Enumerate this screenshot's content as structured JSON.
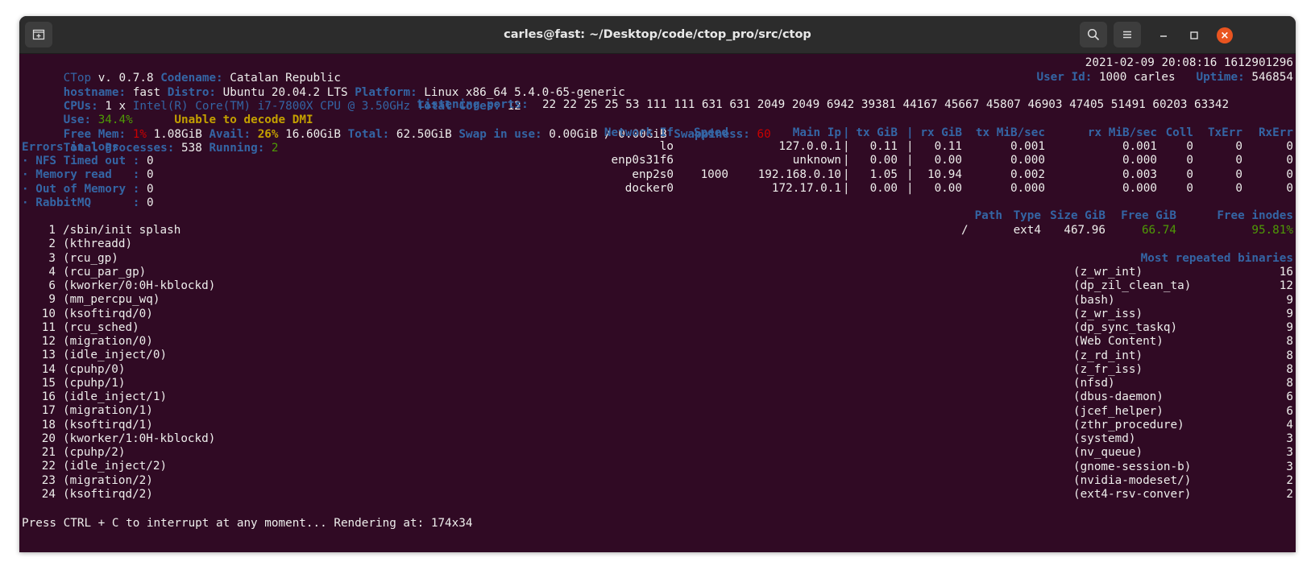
{
  "window": {
    "title": "carles@fast: ~/Desktop/code/ctop_pro/src/ctop"
  },
  "header": {
    "app": "CTop",
    "version": "v. 0.7.8",
    "codename_label": "Codename:",
    "codename": "Catalan Republic",
    "datetime": "2021-02-09 20:08:16 1612901296",
    "hostname_label": "hostname:",
    "hostname": "fast",
    "distro_label": "Distro:",
    "distro": "Ubuntu 20.04.2 LTS",
    "platform_label": "Platform:",
    "platform": "Linux x86_64 5.4.0-65-generic",
    "userid_label": "User Id:",
    "userid": "1000 carles",
    "uptime_label": "Uptime:",
    "uptime": "546854",
    "cpus_label": "CPUs:",
    "cpus_count": "1 x",
    "cpu_model": "Intel(R) Core(TM) i7-7800X CPU @ 3.50GHz",
    "total_cores_label": "Total Cores:",
    "total_cores": "12",
    "use_label": "Use:",
    "use_value": "34.4%",
    "dmi_warning": "Unable to decode DMI",
    "listening_label": "Listening ports:",
    "listening_ports": "22 22 25 25 53 111 111 631 631 2049 2049 6942 39381 44167 45667 45807 46903 47405 51491 60203 63342",
    "freemem_label": "Free Mem:",
    "freemem_pct": "1%",
    "freemem_val": "1.08GiB",
    "avail_label": "Avail:",
    "avail_pct": "26%",
    "avail_val": "16.60GiB",
    "total_label": "Total:",
    "total_val": "62.50GiB",
    "swap_label": "Swap in use:",
    "swap_val": "0.00GiB / 0.00GiB",
    "swappiness_label": "Swappiness:",
    "swappiness_val": "60",
    "processes_label": "Total Processes:",
    "processes_val": "538",
    "running_label": "Running:",
    "running_val": "2"
  },
  "errors": {
    "title": "Errors in logs",
    "items": [
      {
        "label": "· NFS Timed out",
        "sep": ":",
        "value": "0"
      },
      {
        "label": "· Memory read  ",
        "sep": ":",
        "value": "0"
      },
      {
        "label": "· Out of Memory",
        "sep": ":",
        "value": "0"
      },
      {
        "label": "· RabbitMQ     ",
        "sep": ":",
        "value": "0"
      }
    ]
  },
  "network": {
    "headers": [
      "Network If",
      "Speed",
      "Main Ip",
      "|",
      "tx GiB",
      "|",
      "rx GiB",
      "tx MiB/sec",
      "rx MiB/sec",
      "Coll",
      "TxErr",
      "RxErr"
    ],
    "rows": [
      [
        "lo",
        "",
        "127.0.0.1",
        "|",
        "0.11",
        "|",
        "0.11",
        "0.001",
        "0.001",
        "0",
        "0",
        "0"
      ],
      [
        "enp0s31f6",
        "",
        "unknown",
        "|",
        "0.00",
        "|",
        "0.00",
        "0.000",
        "0.000",
        "0",
        "0",
        "0"
      ],
      [
        "enp2s0",
        "1000",
        "192.168.0.10",
        "|",
        "1.05",
        "|",
        "10.94",
        "0.002",
        "0.003",
        "0",
        "0",
        "0"
      ],
      [
        "docker0",
        "",
        "172.17.0.1",
        "|",
        "0.00",
        "|",
        "0.00",
        "0.000",
        "0.000",
        "0",
        "0",
        "0"
      ]
    ]
  },
  "disks": {
    "headers": [
      "Path",
      "Type",
      "Size GiB",
      "Free GiB",
      "Free inodes"
    ],
    "rows": [
      [
        "/",
        "ext4",
        "467.96",
        "66.74",
        "95.81%"
      ]
    ]
  },
  "processes": [
    {
      "pid": "1",
      "name": "/sbin/init splash"
    },
    {
      "pid": "2",
      "name": "(kthreadd)"
    },
    {
      "pid": "3",
      "name": "(rcu_gp)"
    },
    {
      "pid": "4",
      "name": "(rcu_par_gp)"
    },
    {
      "pid": "6",
      "name": "(kworker/0:0H-kblockd)"
    },
    {
      "pid": "9",
      "name": "(mm_percpu_wq)"
    },
    {
      "pid": "10",
      "name": "(ksoftirqd/0)"
    },
    {
      "pid": "11",
      "name": "(rcu_sched)"
    },
    {
      "pid": "12",
      "name": "(migration/0)"
    },
    {
      "pid": "13",
      "name": "(idle_inject/0)"
    },
    {
      "pid": "14",
      "name": "(cpuhp/0)"
    },
    {
      "pid": "15",
      "name": "(cpuhp/1)"
    },
    {
      "pid": "16",
      "name": "(idle_inject/1)"
    },
    {
      "pid": "17",
      "name": "(migration/1)"
    },
    {
      "pid": "18",
      "name": "(ksoftirqd/1)"
    },
    {
      "pid": "20",
      "name": "(kworker/1:0H-kblockd)"
    },
    {
      "pid": "21",
      "name": "(cpuhp/2)"
    },
    {
      "pid": "22",
      "name": "(idle_inject/2)"
    },
    {
      "pid": "23",
      "name": "(migration/2)"
    },
    {
      "pid": "24",
      "name": "(ksoftirqd/2)"
    }
  ],
  "binaries": {
    "title": "Most repeated binaries",
    "items": [
      {
        "name": "(z_wr_int)",
        "count": "16"
      },
      {
        "name": "(dp_zil_clean_ta)",
        "count": "12"
      },
      {
        "name": "(bash)",
        "count": "9"
      },
      {
        "name": "(z_wr_iss)",
        "count": "9"
      },
      {
        "name": "(dp_sync_taskq)",
        "count": "9"
      },
      {
        "name": "(Web Content)",
        "count": "8"
      },
      {
        "name": "(z_rd_int)",
        "count": "8"
      },
      {
        "name": "(z_fr_iss)",
        "count": "8"
      },
      {
        "name": "(nfsd)",
        "count": "8"
      },
      {
        "name": "(dbus-daemon)",
        "count": "6"
      },
      {
        "name": "(jcef_helper)",
        "count": "6"
      },
      {
        "name": "(zthr_procedure)",
        "count": "4"
      },
      {
        "name": "(systemd)",
        "count": "3"
      },
      {
        "name": "(nv_queue)",
        "count": "3"
      },
      {
        "name": "(gnome-session-b)",
        "count": "3"
      },
      {
        "name": "(nvidia-modeset/)",
        "count": "2"
      },
      {
        "name": "(ext4-rsv-conver)",
        "count": "2"
      }
    ]
  },
  "footer": {
    "text": "Press CTRL + C to interrupt at any moment... Rendering at: 174x34"
  },
  "colors": {
    "terminal_bg": "#300a24",
    "label_blue": "#3465a4",
    "green": "#4e9a06",
    "yellow": "#c4a000",
    "red": "#cc0000",
    "titlebar_bg": "#2c2c2c",
    "close_orange": "#e95420"
  },
  "icons": {
    "new_tab": "new-tab-icon",
    "search": "search-icon",
    "menu": "hamburger-menu-icon",
    "minimize": "minimize-icon",
    "maximize": "maximize-icon",
    "close": "close-icon"
  }
}
